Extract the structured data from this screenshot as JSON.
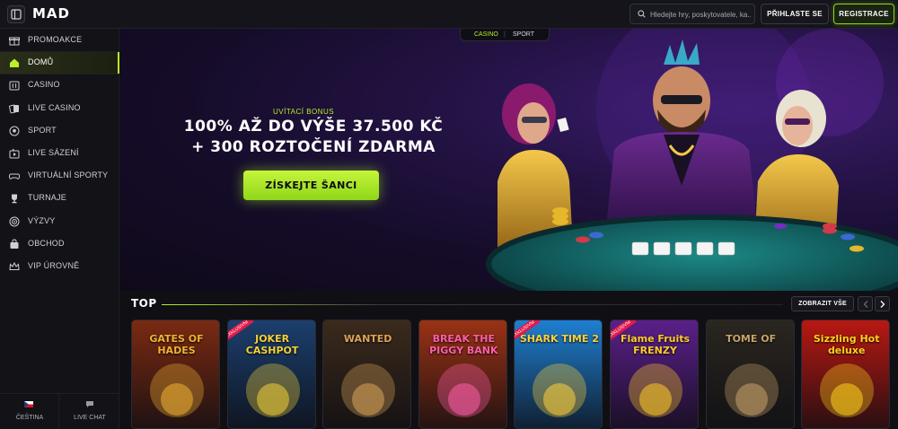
{
  "header": {
    "logo": "MAD",
    "search_placeholder": "Hledejte hry, poskytovatele, ka...",
    "login_label": "PŘIHLASTE SE",
    "register_label": "REGISTRACE"
  },
  "sidebar": {
    "items": [
      {
        "label": "PROMOAKCE",
        "icon": "gift-icon"
      },
      {
        "label": "DOMŮ",
        "icon": "home-icon",
        "active": true
      },
      {
        "label": "CASINO",
        "icon": "slot-machine-icon"
      },
      {
        "label": "LIVE CASINO",
        "icon": "cards-icon"
      },
      {
        "label": "SPORT",
        "icon": "soccer-ball-icon"
      },
      {
        "label": "LIVE SÁZENÍ",
        "icon": "live-tv-icon"
      },
      {
        "label": "VIRTUÁLNÍ SPORTY",
        "icon": "gamepad-icon"
      },
      {
        "label": "TURNAJE",
        "icon": "trophy-icon"
      },
      {
        "label": "VÝZVY",
        "icon": "target-icon"
      },
      {
        "label": "OBCHOD",
        "icon": "shop-bag-icon"
      },
      {
        "label": "VIP ÚROVNĚ",
        "icon": "crown-icon"
      }
    ],
    "language": "ČEŠTINA",
    "live_chat": "LIVE CHAT"
  },
  "hero": {
    "switch_casino": "CASINO",
    "switch_divider": "|",
    "switch_sport": "SPORT",
    "subtitle": "UVÍTACÍ BONUS",
    "line1": "100% AŽ DO VÝŠE 37.500 KČ",
    "line2": "+ 300 ROZTOČENÍ ZDARMA",
    "cta": "ZÍSKEJTE ŠANCI"
  },
  "top_section": {
    "title": "TOP",
    "show_all": "ZOBRAZIT VŠE",
    "games": [
      {
        "name": "GATES OF HADES",
        "bg": "#7a2a12",
        "accent": "#f2b233"
      },
      {
        "name": "JOKER CASHPOT",
        "bg": "#1b3f6e",
        "accent": "#f4d23a",
        "badge": "EXKLUSIVNÍ"
      },
      {
        "name": "WANTED",
        "bg": "#3b2a1c",
        "accent": "#d9a45a"
      },
      {
        "name": "BREAK THE PIGGY BANK",
        "bg": "#9a3214",
        "accent": "#ff5fa8"
      },
      {
        "name": "SHARK TIME 2",
        "bg": "#1f7fd1",
        "accent": "#ffd23a",
        "badge": "EXKLUSIVNÍ"
      },
      {
        "name": "Flame Fruits FRENZY",
        "bg": "#5b1f8a",
        "accent": "#ffcc2a",
        "badge": "EXKLUSIVNÍ"
      },
      {
        "name": "TOME OF",
        "bg": "#2a2620",
        "accent": "#c9a36a"
      },
      {
        "name": "Sizzling Hot deluxe",
        "bg": "#b81812",
        "accent": "#ffd21a"
      }
    ]
  },
  "colors": {
    "accent": "#b8f02a",
    "background": "#0f0f14",
    "sidebar": "#121217"
  }
}
